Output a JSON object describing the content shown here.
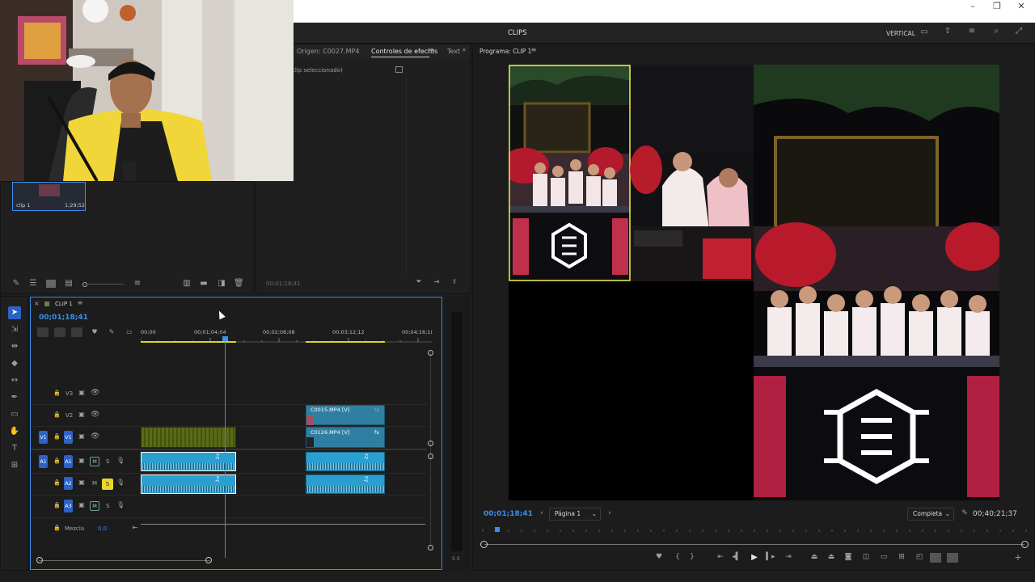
{
  "window": {
    "minimize": "–",
    "maximize": "❐",
    "close": "✕"
  },
  "workspace": {
    "title": "CLIPS",
    "layout_label": "VERTICAL"
  },
  "source_panel": {
    "tab_source": "Origen: C0027.MP4",
    "tab_effects": "Controles de efectos",
    "tab_text": "Text",
    "no_clip": "clip seleccionado)",
    "timecode": "00;01;18;41"
  },
  "project_panel": {
    "clip_name": "clip 1",
    "clip_duration": "1;29;52"
  },
  "timeline": {
    "sequence_name": "CLIP 1",
    "playhead_timecode": "00;01;18;41",
    "ruler_labels": [
      "00;00",
      "00;01;04;04",
      "00;02;08;08",
      "00;03;12;12",
      "00;04;16;1("
    ],
    "tracks": [
      {
        "name": "V3",
        "type": "video"
      },
      {
        "name": "V2",
        "type": "video"
      },
      {
        "name": "V1",
        "type": "video",
        "source": "V1"
      },
      {
        "name": "A1",
        "type": "audio",
        "source": "A1",
        "mute": "M",
        "solo": "S"
      },
      {
        "name": "A2",
        "type": "audio",
        "mute": "M",
        "solo": "S"
      },
      {
        "name": "A3",
        "type": "audio",
        "mute": "M",
        "solo": "S"
      }
    ],
    "mix_label": "Mezcla",
    "mix_value": "0,0",
    "clips": {
      "v2": "C0015.MP4 [V]",
      "v1b": "C0126.MP4 [V]",
      "fx": "fx"
    },
    "meter_label": "S S"
  },
  "program_monitor": {
    "title": "Programa: CLIP 1",
    "timecode": "00;01;18;41",
    "page_select": "Página 1",
    "quality_select": "Completa",
    "duration": "00;40;21;37"
  },
  "colors": {
    "accent_blue": "#3d8ee8",
    "track_blue": "#2b63c6",
    "audio_clip": "#2aa0d0",
    "video_clip_green": "#4c5b10",
    "selection_yellow": "#f0f050"
  }
}
